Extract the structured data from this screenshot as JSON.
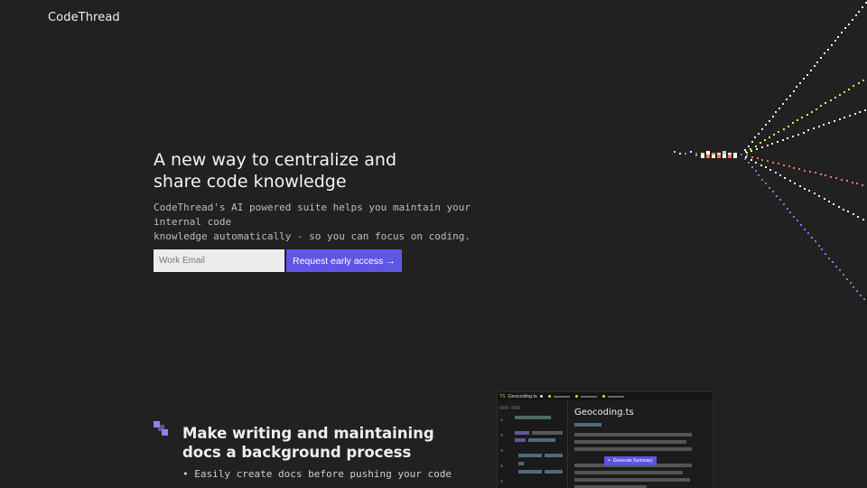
{
  "brand": {
    "name": "CodeThread"
  },
  "hero": {
    "title_lines": [
      "A new way to centralize and",
      "share code knowledge"
    ],
    "subtitle_lines": [
      "CodeThread's AI powered suite helps you maintain your internal code",
      "knowledge automatically - so you can focus on coding."
    ],
    "email_placeholder": "Work Email",
    "cta_label": "Request early access",
    "cta_arrow": "→"
  },
  "feature": {
    "title_lines": [
      "Make writing and maintaining",
      "docs a background process"
    ],
    "bullets": [
      "Easily create docs before pushing your code"
    ]
  },
  "editor": {
    "tab_lang": "TS",
    "tab_file": "Geocoding.ts",
    "file_title": "Geocoding.ts",
    "generate_label": "Generate Summary",
    "generate_icon": "+"
  },
  "colors": {
    "background": "#212121",
    "accent": "#5f55e6",
    "feature_icon": "#8b80ff",
    "burst_yellow": "#d8ef5c",
    "burst_orange": "#ee7a5a",
    "burst_purple": "#7c78f0",
    "burst_white": "#f2f2f2"
  }
}
